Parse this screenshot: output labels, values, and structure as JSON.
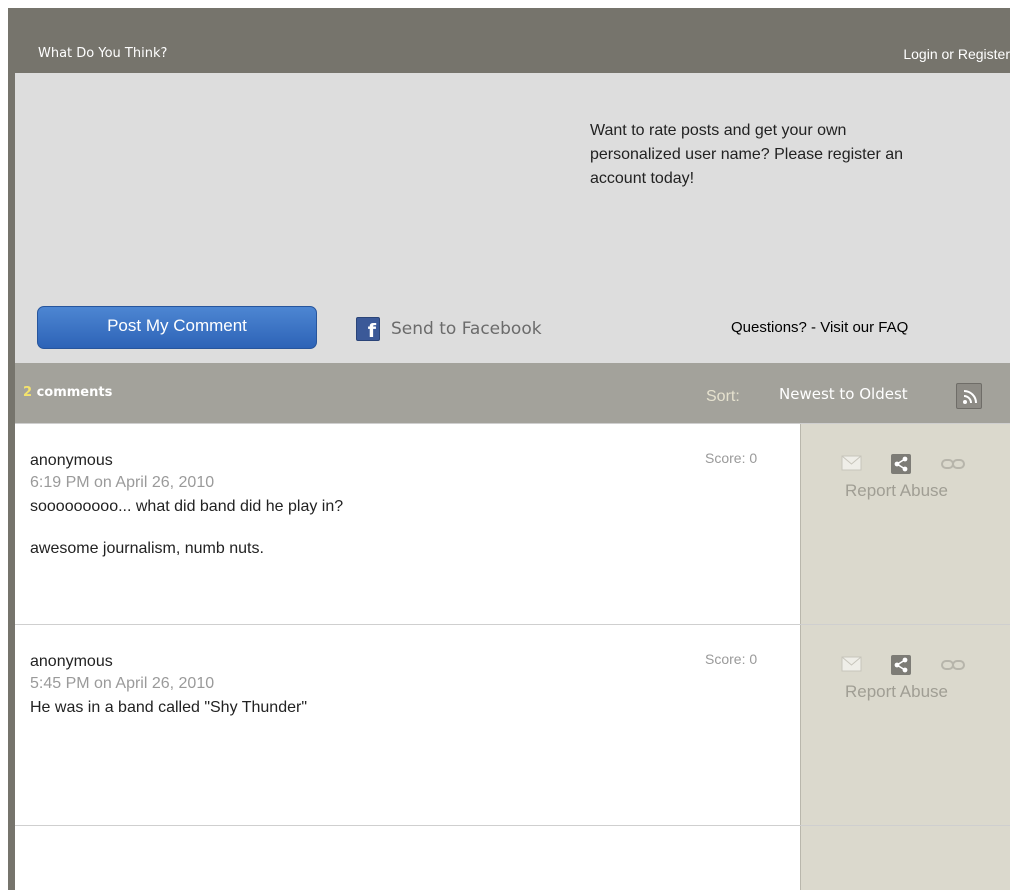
{
  "header": {
    "title": "What Do You Think?",
    "login": "Login",
    "or": "or",
    "register": "Register"
  },
  "compose": {
    "promo": "Want to rate posts and get your own personalized user name? Please register an account today!",
    "post_button": "Post My Comment",
    "facebook_label": "Send to Facebook",
    "faq": "Questions? - Visit our FAQ"
  },
  "countbar": {
    "count": "2",
    "count_label": "comments",
    "sort_label": "Sort:",
    "sort_value": "Newest to Oldest"
  },
  "comments": [
    {
      "author": "anonymous",
      "date": "6:19 PM on April 26, 2010",
      "score": "Score: 0",
      "body": [
        "sooooooooo... what did band did he play in?",
        "awesome journalism, numb nuts."
      ],
      "report": "Report Abuse"
    },
    {
      "author": "anonymous",
      "date": "5:45 PM on April 26, 2010",
      "score": "Score: 0",
      "body": [
        "He was in a band called \"Shy Thunder\""
      ],
      "report": "Report Abuse"
    }
  ],
  "colors": {
    "header_bg": "#76746c",
    "compose_bg": "#dddddd",
    "button_blue": "#3a73c5",
    "count_highlight": "#f4e36c",
    "sidebar_bg": "#dbd9cd"
  }
}
